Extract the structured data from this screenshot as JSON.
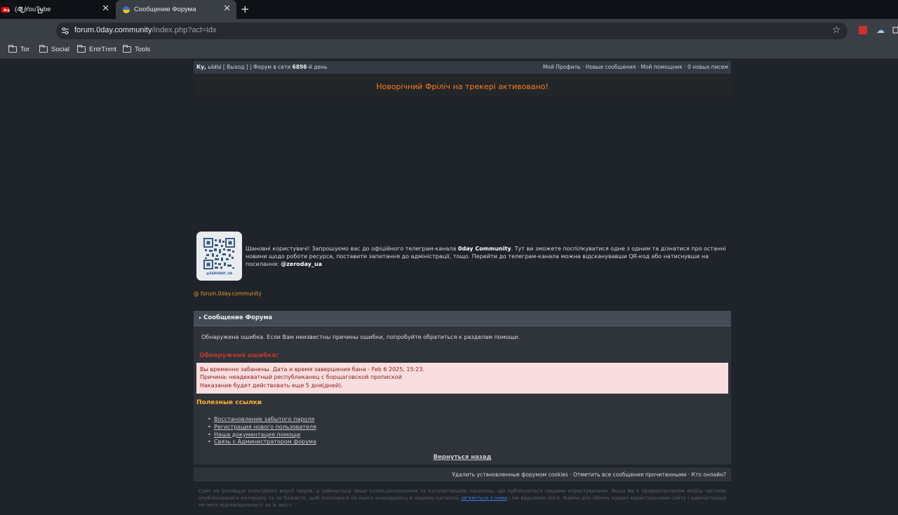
{
  "browser": {
    "tabs": [
      {
        "title": "(4) YouTube",
        "icon": "youtube-icon"
      },
      {
        "title": "Сообщение Форума",
        "icon": "ukraine-flag-icon",
        "active": true
      }
    ],
    "url_host": "forum.0day.community",
    "url_path": "/index.php?act=idx",
    "bookmarks": [
      "Tor",
      "Social",
      "EntrTnmt",
      "Tools"
    ]
  },
  "forum": {
    "userbar": {
      "greeting": "Ку,",
      "username": "ыЫЫ",
      "logout_open": "[ ",
      "logout": "Выход",
      "logout_close": " ] | Форум в сети ",
      "days": "6898",
      "days_suffix": "-й день",
      "nav": [
        "Мой Профиль",
        "Новые сообщения",
        "Мой помощник",
        "0 новых писем"
      ]
    },
    "announcement": "Новорічний Фріліч на трекері активовано!",
    "telegram": {
      "qr_caption": "@ZERODAY_UA",
      "text_1": "Шановні користувачі! Запрошуємо вас до офіційного телеграм-канала ",
      "channel_name": "0day Community",
      "text_2": ". Тут ви зможете поспілкуватися одне з одним та дізнатися про останні новини щодо роботи ресурса, поставити запитання до адміністрації, тощо. Перейти до телеграм-канала можна відсканувавши QR-код або натиснувши на посилання: ",
      "handle": "@zeroday_ua",
      "site_link": "@ forum.0day.community"
    },
    "message": {
      "header": "Сообщение Форума",
      "intro": "Обнаружена ошибка. Если Вам неизвестны причины ошибки, попробуйте обратиться к разделам помощи.",
      "error_title": "Обнаружена ошибка:",
      "error_lines": [
        "Вы временно забанены. Дата и время завершения бана - Feb 6 2025, 15:23.",
        "Причина: неадекватный республиканец с борщаговской пропиской",
        "Наказание будет действовать еще 5 дня(дней)."
      ],
      "links_title": "Полезные ссылки",
      "links": [
        "Восстановление забытого пароля",
        "Регистрация нового пользователя",
        "Наша документация помощи",
        "Связь с Администратором форума"
      ],
      "back": "Вернуться назад"
    },
    "footer": {
      "links": "Удалить установленные форумом cookies · Отметить все сообщения прочитанными · Кто онлайн?",
      "disclaimer_1": "Сайт не розміщує електронні версії творів, а займається лише колекціонуванням та каталогізацією посилань, що публікуються нашими користувачами. Якщо Ви є правовласником якоїсь частини опублікованого матеріалу та не бажаєте, щоб посилання на нього знаходилось в нашому каталозі, ",
      "disclaimer_link": "зв'яжіться з нами",
      "disclaimer_2": " і ми видалимо його. Файли для обміну надані користувачами сайту і адміністрація не несе відповідальності за їх зміст."
    }
  },
  "colors": {
    "page_bg": "#1f232a",
    "announcement": "#ff7a1a",
    "error_title": "#c0392b",
    "error_bg": "#f8dede",
    "links_title": "#ffb02e"
  }
}
